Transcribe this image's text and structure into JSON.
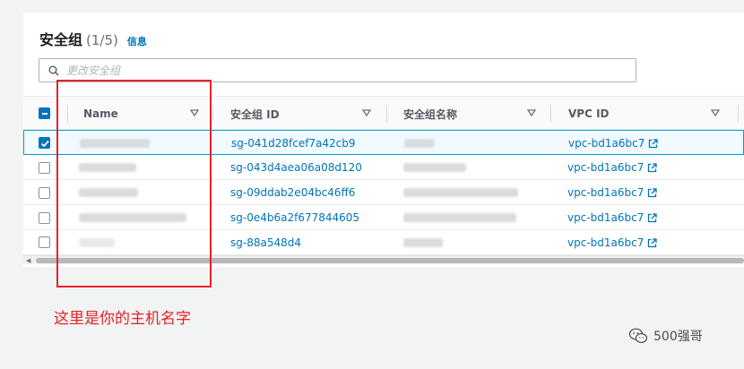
{
  "header": {
    "title": "安全组",
    "count": "(1/5)",
    "info_link": "信息"
  },
  "search": {
    "placeholder": "更改安全组",
    "value": ""
  },
  "columns": [
    "Name",
    "安全组 ID",
    "安全组名称",
    "VPC ID"
  ],
  "rows": [
    {
      "selected": true,
      "sg_id": "sg-041d28fcef7a42cb9",
      "vpc_id": "vpc-bd1a6bc7"
    },
    {
      "selected": false,
      "sg_id": "sg-043d4aea06a08d120",
      "vpc_id": "vpc-bd1a6bc7"
    },
    {
      "selected": false,
      "sg_id": "sg-09ddab2e04bc46ff6",
      "vpc_id": "vpc-bd1a6bc7"
    },
    {
      "selected": false,
      "sg_id": "sg-0e4b6a2f677844605",
      "vpc_id": "vpc-bd1a6bc7"
    },
    {
      "selected": false,
      "sg_id": "sg-88a548d4",
      "vpc_id": "vpc-bd1a6bc7"
    }
  ],
  "annotation": {
    "text": "这里是你的主机名字"
  },
  "watermark": {
    "text": "500强哥"
  },
  "colors": {
    "link": "#0073bb",
    "annotation": "#e4232a",
    "selected_row": "#f1faff",
    "selected_border": "#00a1c9"
  },
  "icons": [
    "search-icon",
    "sort-icon",
    "external-link-icon",
    "checkbox-icon",
    "wechat-icon"
  ]
}
